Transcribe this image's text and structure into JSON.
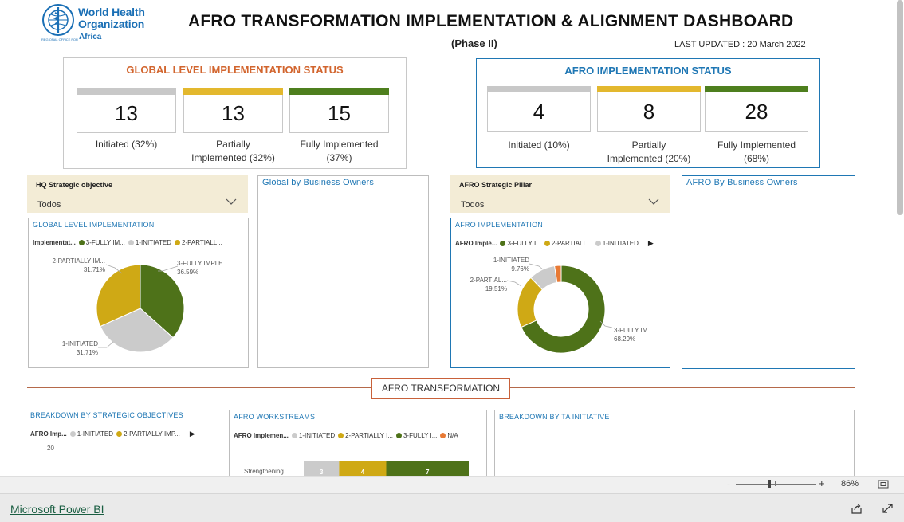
{
  "logo": {
    "line1": "World Health",
    "line2": "Organization",
    "small": "REGIONAL OFFICE FOR",
    "region": "Africa"
  },
  "header": {
    "title": "AFRO TRANSFORMATION IMPLEMENTATION & ALIGNMENT DASHBOARD",
    "phase": "(Phase II)",
    "updated": "LAST UPDATED : 20 March 2022"
  },
  "global_status": {
    "title": "GLOBAL LEVEL IMPLEMENTATION STATUS",
    "title_color": "#d2652e",
    "kpis": [
      {
        "value": "13",
        "label1": "Initiated (32%)",
        "label2": "",
        "color": "#c8c8c8"
      },
      {
        "value": "13",
        "label1": "Partially",
        "label2": "Implemented (32%)",
        "color": "#e3b82e"
      },
      {
        "value": "15",
        "label1": "Fully Implemented",
        "label2": "(37%)",
        "color": "#4e7f1e"
      }
    ]
  },
  "afro_status": {
    "title": "AFRO IMPLEMENTATION STATUS",
    "title_color": "#1f77b4",
    "kpis": [
      {
        "value": "4",
        "label1": "Initiated (10%)",
        "label2": "",
        "color": "#c8c8c8"
      },
      {
        "value": "8",
        "label1": "Partially",
        "label2": "Implemented (20%)",
        "color": "#e3b82e"
      },
      {
        "value": "28",
        "label1": "Fully Implemented",
        "label2": "(68%)",
        "color": "#4e7f1e"
      }
    ]
  },
  "slicers": {
    "hq": {
      "title": "HQ Strategic objective",
      "value": "Todos"
    },
    "afro": {
      "title": "AFRO Strategic Pillar",
      "value": "Todos"
    }
  },
  "panels": {
    "global_owners": "Global by Business Owners",
    "afro_owners": "AFRO By Business Owners",
    "global_impl": "GLOBAL LEVEL IMPLEMENTATION",
    "afro_impl": "AFRO IMPLEMENTATION",
    "breakdown_obj": "BREAKDOWN BY STRATEGIC OBJECTIVES",
    "workstreams": "AFRO WORKSTREAMS",
    "breakdown_ta": "BREAKDOWN BY TA INITIATIVE"
  },
  "section_button": "AFRO TRANSFORMATION",
  "legends": {
    "global": {
      "prefix": "Implementat...",
      "items": [
        "3-FULLY IM...",
        "1-INITIATED",
        "2-PARTIALL..."
      ]
    },
    "afro": {
      "prefix": "AFRO Imple...",
      "items": [
        "3-FULLY I...",
        "2-PARTIALL...",
        "1-INITIATED"
      ]
    },
    "obj": {
      "prefix": "AFRO Imp...",
      "items": [
        "1-INITIATED",
        "2-PARTIALLY IMP..."
      ]
    },
    "workstreams": {
      "prefix": "AFRO Implemen...",
      "items": [
        "1-INITIATED",
        "2-PARTIALLY I...",
        "3-FULLY I...",
        "N/A"
      ]
    }
  },
  "axis": {
    "obj_tick": "20",
    "ws_category": "Strengthening ..."
  },
  "colors": {
    "fully": "#4e7219",
    "partial": "#cfa915",
    "initiated": "#cbcbcb",
    "na": "#e87a35"
  },
  "chart_data": [
    {
      "type": "pie",
      "title": "GLOBAL LEVEL IMPLEMENTATION",
      "slices": [
        {
          "label": "3-FULLY IMPLE...",
          "value": 36.59
        },
        {
          "label": "1-INITIATED",
          "value": 31.71
        },
        {
          "label": "2-PARTIALLY IM...",
          "value": 31.71
        }
      ],
      "labels": {
        "fully": "3-FULLY IMPLE...",
        "fully_pct": "36.59%",
        "initiated": "1-INITIATED",
        "initiated_pct": "31.71%",
        "partial": "2-PARTIALLY IM...",
        "partial_pct": "31.71%"
      }
    },
    {
      "type": "pie",
      "title": "AFRO IMPLEMENTATION",
      "slices": [
        {
          "label": "3-FULLY IM...",
          "value": 68.29
        },
        {
          "label": "2-PARTIAL...",
          "value": 19.51
        },
        {
          "label": "1-INITIATED",
          "value": 9.76
        },
        {
          "label": "N/A",
          "value": 2.44
        }
      ],
      "labels": {
        "fully": "3-FULLY IM...",
        "fully_pct": "68.29%",
        "partial": "2-PARTIAL...",
        "partial_pct": "19.51%",
        "initiated": "1-INITIATED",
        "initiated_pct": "9.76%"
      }
    },
    {
      "type": "bar",
      "title": "AFRO WORKSTREAMS",
      "categories": [
        "Strengthening ..."
      ],
      "series": [
        {
          "name": "1-INITIATED",
          "values": [
            3
          ]
        },
        {
          "name": "2-PARTIALLY I...",
          "values": [
            4
          ]
        },
        {
          "name": "3-FULLY I...",
          "values": [
            7
          ]
        }
      ]
    }
  ],
  "zoom": {
    "minus": "-",
    "plus": "+",
    "value": "86%"
  },
  "footer": {
    "link": "Microsoft Power BI"
  }
}
